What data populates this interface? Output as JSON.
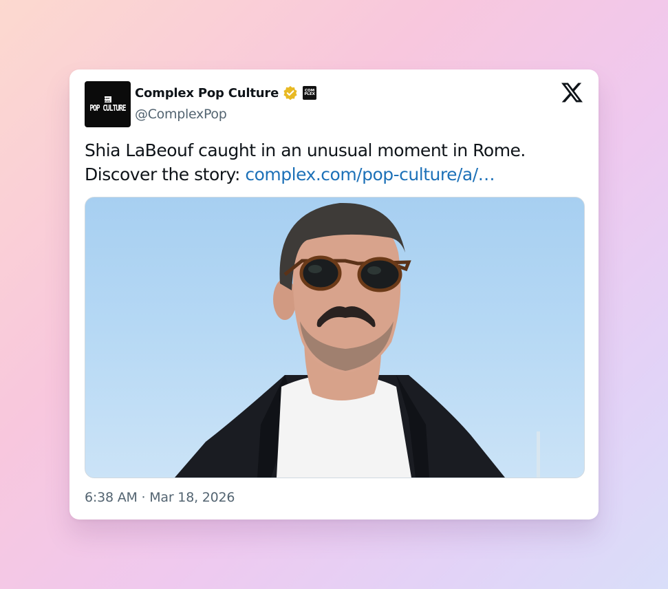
{
  "account": {
    "display_name": "Complex Pop Culture",
    "handle": "@ComplexPop",
    "avatar_text": "POP CULTURE",
    "avatar_mini_text": "COM PLEX",
    "affiliate_badge_text": "COM PLEX",
    "verified_badge_color": "#e8b923"
  },
  "tweet": {
    "text_line1": "Shia LaBeouf caught in an unusual moment in Rome.",
    "text_line2_prefix": "Discover the story: ",
    "link": "complex.com/pop-culture/a/…",
    "timestamp": "6:38 AM · Mar 18, 2026"
  },
  "icons": {
    "platform_logo": "x-logo-icon",
    "verified": "verified-badge-icon"
  },
  "colors": {
    "link": "#1d71b8",
    "secondary_text": "#536471",
    "primary_text": "#0f1419"
  }
}
